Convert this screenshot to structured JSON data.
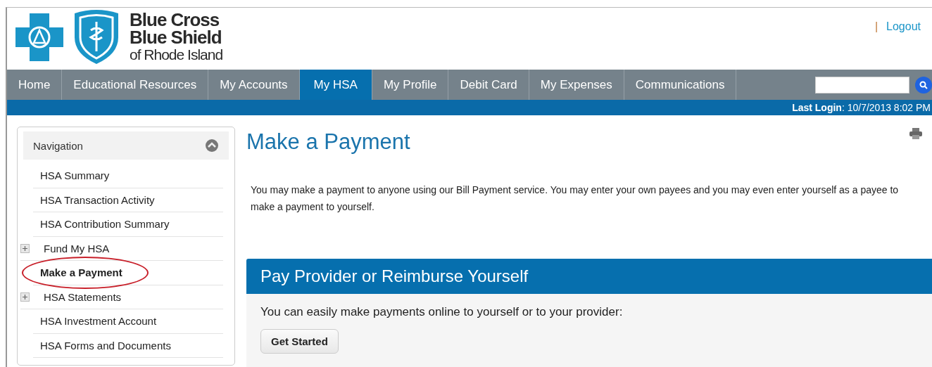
{
  "header": {
    "brand_lines": [
      "Blue Cross",
      "Blue Shield",
      "of Rhode Island"
    ],
    "separator": "|",
    "logout": "Logout"
  },
  "tabs": [
    {
      "label": "Home",
      "selected": false
    },
    {
      "label": "Educational Resources",
      "selected": false
    },
    {
      "label": "My Accounts",
      "selected": false
    },
    {
      "label": "My HSA",
      "selected": true
    },
    {
      "label": "My Profile",
      "selected": false
    },
    {
      "label": "Debit Card",
      "selected": false
    },
    {
      "label": "My Expenses",
      "selected": false
    },
    {
      "label": "Communications",
      "selected": false
    }
  ],
  "last_login": {
    "label": "Last Login",
    "value": ": 10/7/2013 8:02 PM"
  },
  "sidebar": {
    "title": "Navigation",
    "expanded": true,
    "items": [
      {
        "label": "HSA Summary",
        "selected": false,
        "expandable": false
      },
      {
        "label": "HSA Transaction Activity",
        "selected": false,
        "expandable": false
      },
      {
        "label": "HSA Contribution Summary",
        "selected": false,
        "expandable": false
      },
      {
        "label": "Fund My HSA",
        "selected": false,
        "expandable": true
      },
      {
        "label": "Make a Payment",
        "selected": true,
        "expandable": false,
        "circled": true
      },
      {
        "label": "HSA Statements",
        "selected": false,
        "expandable": true
      },
      {
        "label": "HSA Investment Account",
        "selected": false,
        "expandable": false
      },
      {
        "label": "HSA Forms and Documents",
        "selected": false,
        "expandable": false
      }
    ]
  },
  "main": {
    "title": "Make a Payment",
    "intro": "You may make a payment to anyone using our Bill Payment service. You may enter your own payees and you may even enter yourself as a payee to make a payment to yourself.",
    "panel": {
      "title": "Pay Provider or Reimburse Yourself",
      "text": "You can easily make payments online to yourself or to your provider:",
      "button": "Get Started"
    }
  }
}
